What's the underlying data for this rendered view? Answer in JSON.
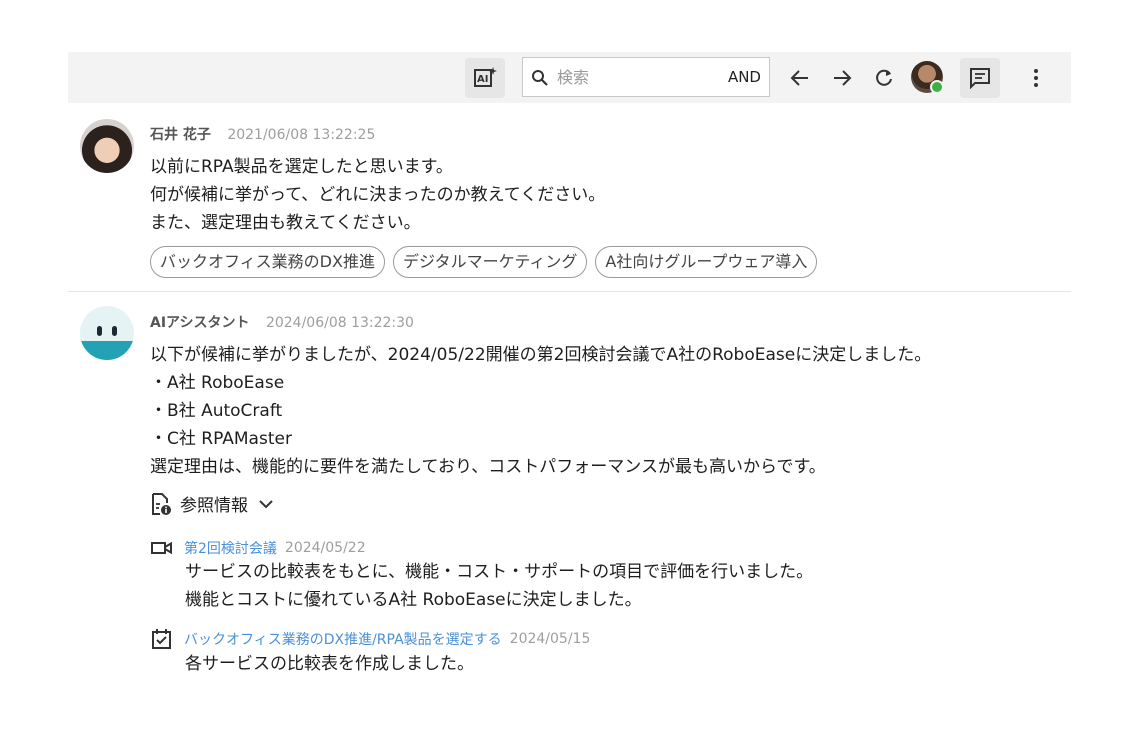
{
  "toolbar": {
    "search_placeholder": "検索",
    "search_mode": "AND",
    "icons": [
      "ai-summary-icon",
      "search-icon",
      "arrow-left-icon",
      "arrow-right-icon",
      "refresh-icon",
      "chat-icon",
      "more-vert-icon"
    ]
  },
  "messages": [
    {
      "name": "石井 花子",
      "time": "2021/06/08 13:22:25",
      "lines": [
        "以前にRPA製品を選定したと思います。",
        "何が候補に挙がって、どれに決まったのか教えてください。",
        "また、選定理由も教えてください。"
      ],
      "tags": [
        "バックオフィス業務のDX推進",
        "デジタルマーケティング",
        "A社向けグループウェア導入"
      ]
    },
    {
      "name": "AIアシスタント",
      "time": "2024/06/08 13:22:30",
      "lines": [
        "以下が候補に挙がりましたが、2024/05/22開催の第2回検討会議でA社のRoboEaseに決定しました。",
        "・A社 RoboEase",
        "・B社 AutoCraft",
        "・C社 RPAMaster",
        "選定理由は、機能的に要件を満たしており、コストパフォーマンスが最も高いからです。"
      ],
      "reference_label": "参照情報",
      "references": [
        {
          "icon": "video-icon",
          "title": "第2回検討会議",
          "date": "2024/05/22",
          "lines": [
            "サービスの比較表をもとに、機能・コスト・サポートの項目で評価を行いました。",
            "機能とコストに優れているA社 RoboEaseに決定しました。"
          ]
        },
        {
          "icon": "task-icon",
          "title": "バックオフィス業務のDX推進/RPA製品を選定する",
          "date": "2024/05/15",
          "lines": [
            "各サービスの比較表を作成しました。"
          ]
        }
      ]
    }
  ],
  "colors": {
    "link": "#4a90d9",
    "bot_accent": "#23a2b6",
    "online": "#3cb043"
  }
}
